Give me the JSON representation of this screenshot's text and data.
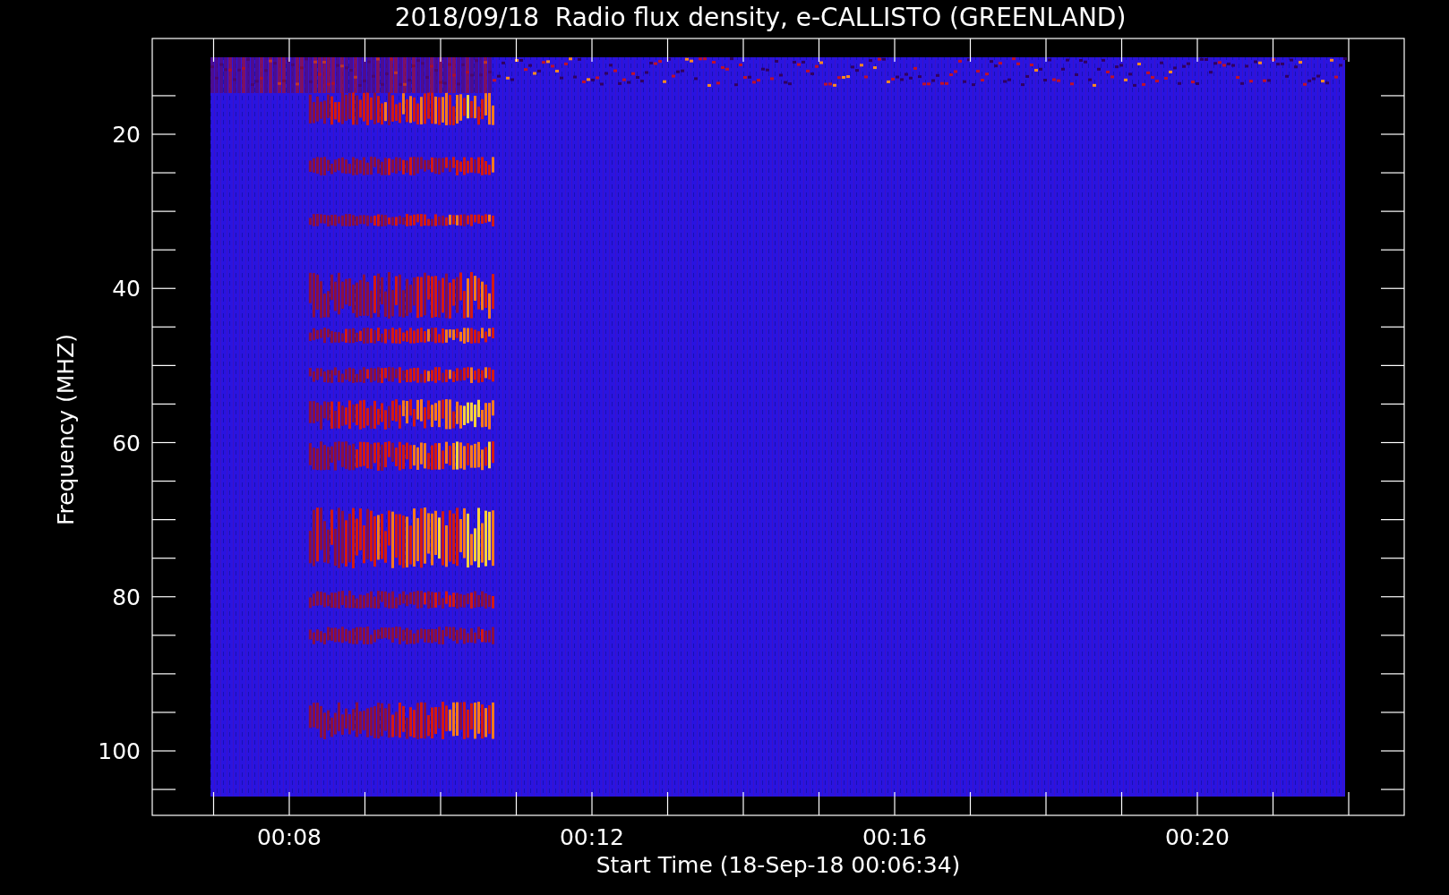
{
  "title": "2018/09/18  Radio flux density, e-CALLISTO (GREENLAND)",
  "y_axis": {
    "label": "Frequency (MHZ)",
    "ticks": [
      "20",
      "40",
      "60",
      "80",
      "100"
    ]
  },
  "x_axis": {
    "label": "Start Time (18-Sep-18 00:06:34)",
    "ticks": [
      "00:08",
      "00:12",
      "00:16",
      "00:20"
    ]
  }
}
